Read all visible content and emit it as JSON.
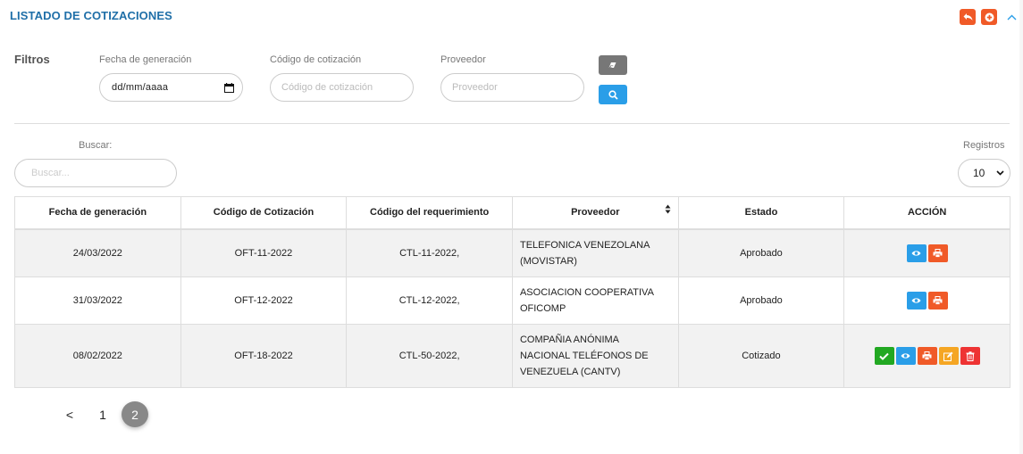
{
  "header": {
    "title": "LISTADO DE COTIZACIONES",
    "back_icon": "reply-icon",
    "add_icon": "plus-circle-icon",
    "collapse_icon": "chevron-up-icon",
    "accent": "#f05a28",
    "title_color": "#1f6fa8"
  },
  "filters": {
    "section_label": "Filtros",
    "date_label": "Fecha de generación",
    "date_value": "dd/mm/aaaa",
    "code_label": "Código de cotización",
    "code_placeholder": "Código de cotización",
    "provider_label": "Proveedor",
    "provider_placeholder": "Proveedor",
    "clear_icon": "eraser-icon",
    "search_icon": "search-icon"
  },
  "list_controls": {
    "search_label": "Buscar:",
    "search_placeholder": "Buscar...",
    "records_label": "Registros",
    "records_value": "10"
  },
  "table": {
    "columns": [
      "Fecha de generación",
      "Código de Cotización",
      "Código del requerimiento",
      "Proveedor",
      "Estado",
      "ACCIÓN"
    ],
    "rows": [
      {
        "fecha": "24/03/2022",
        "codigo": "OFT-11-2022",
        "requerimiento": "CTL-11-2022,",
        "proveedor_l1": "TELEFONICA VENEZOLANA",
        "proveedor_l2": "(MOVISTAR)",
        "estado": "Aprobado",
        "actions": [
          "eye-icon",
          "print-icon"
        ]
      },
      {
        "fecha": "31/03/2022",
        "codigo": "OFT-12-2022",
        "requerimiento": "CTL-12-2022,",
        "proveedor_l1": "ASOCIACION COOPERATIVA",
        "proveedor_l2": "OFICOMP",
        "estado": "Aprobado",
        "actions": [
          "eye-icon",
          "print-icon"
        ]
      },
      {
        "fecha": "08/02/2022",
        "codigo": "OFT-18-2022",
        "requerimiento": "CTL-50-2022,",
        "proveedor_l1": "COMPAÑIA ANÓNIMA",
        "proveedor_l2": "NACIONAL TELÉFONOS DE",
        "proveedor_l3": "VENEZUELA (CANTV)",
        "estado": "Cotizado",
        "actions": [
          "check-icon",
          "eye-icon",
          "print-icon",
          "edit-icon",
          "trash-icon"
        ]
      }
    ]
  },
  "pagination": {
    "prev": "<",
    "pages": [
      "1",
      "2"
    ],
    "active": "2"
  }
}
